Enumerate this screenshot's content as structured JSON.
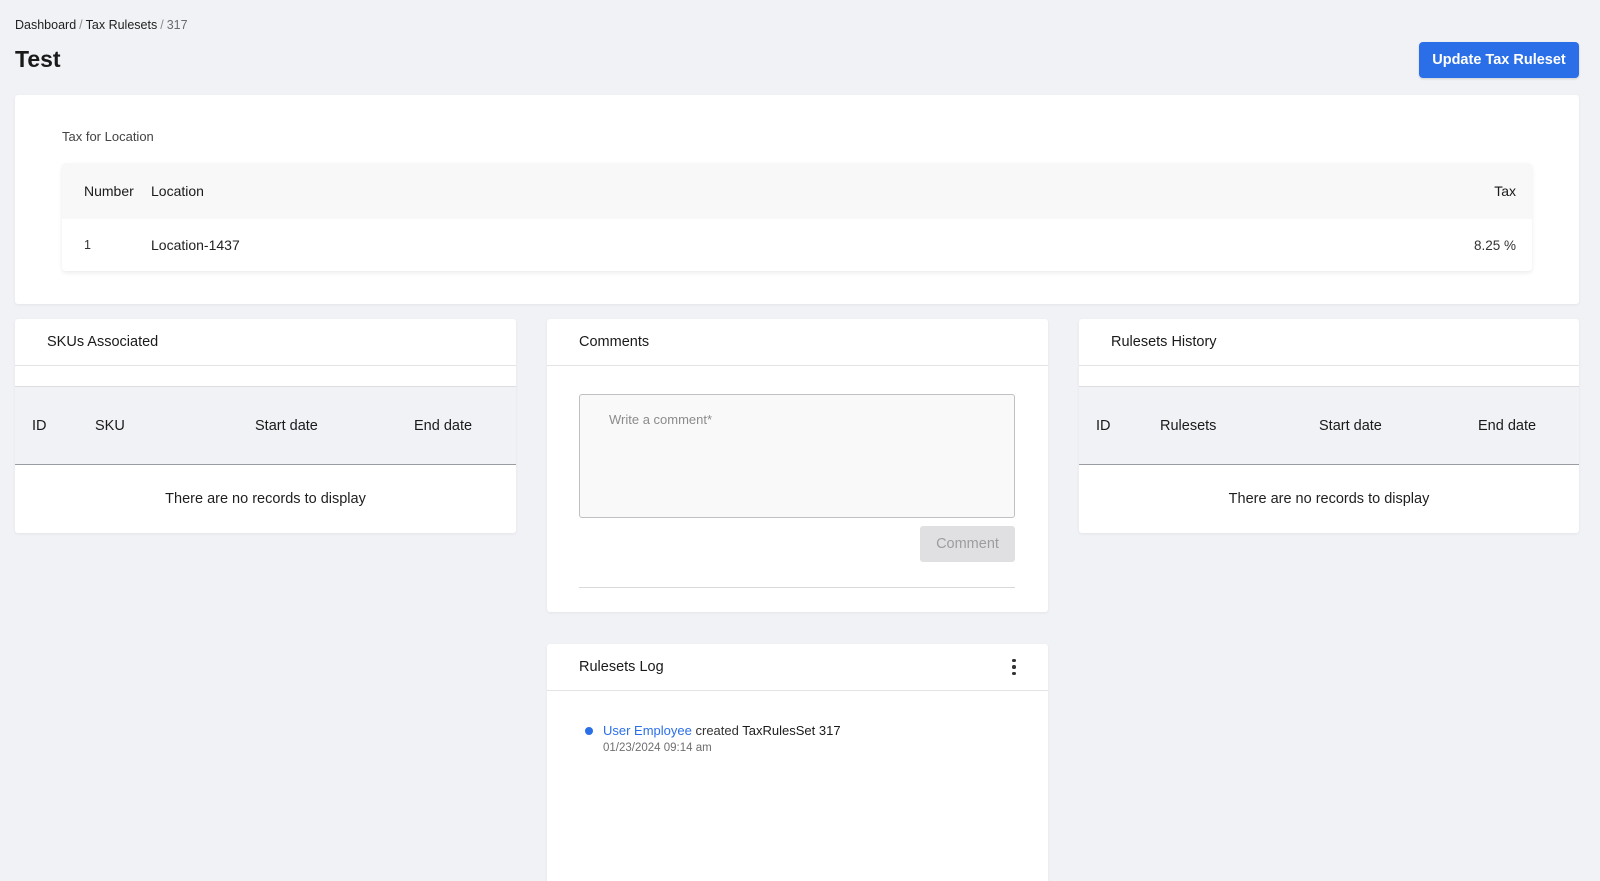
{
  "breadcrumb": {
    "items": [
      "Dashboard",
      "Tax Rulesets"
    ],
    "separator": "/",
    "current": "317"
  },
  "page": {
    "title": "Test",
    "primary_action": "Update Tax Ruleset"
  },
  "tax_for_location": {
    "label": "Tax for Location",
    "columns": [
      "Number",
      "Location",
      "Tax"
    ],
    "rows": [
      {
        "number": "1",
        "location": "Location-1437",
        "tax": "8.25 %"
      }
    ]
  },
  "skus": {
    "title": "SKUs Associated",
    "columns": [
      "ID",
      "SKU",
      "Start date",
      "End date"
    ],
    "empty_text": "There are no records to display"
  },
  "comments": {
    "title": "Comments",
    "placeholder": "Write a comment*",
    "value": "",
    "submit_label": "Comment"
  },
  "history": {
    "title": "Rulesets History",
    "columns": [
      "ID",
      "Rulesets",
      "Start date",
      "End date"
    ],
    "empty_text": "There are no records to display"
  },
  "log": {
    "title": "Rulesets Log",
    "entries": [
      {
        "user": "User Employee",
        "action": "created",
        "object": "TaxRulesSet 317",
        "time": "01/23/2024 09:14 am"
      }
    ]
  },
  "colors": {
    "accent": "#2b6fe8",
    "background": "#f1f2f6",
    "disabled_button": "#e0e0e2"
  }
}
